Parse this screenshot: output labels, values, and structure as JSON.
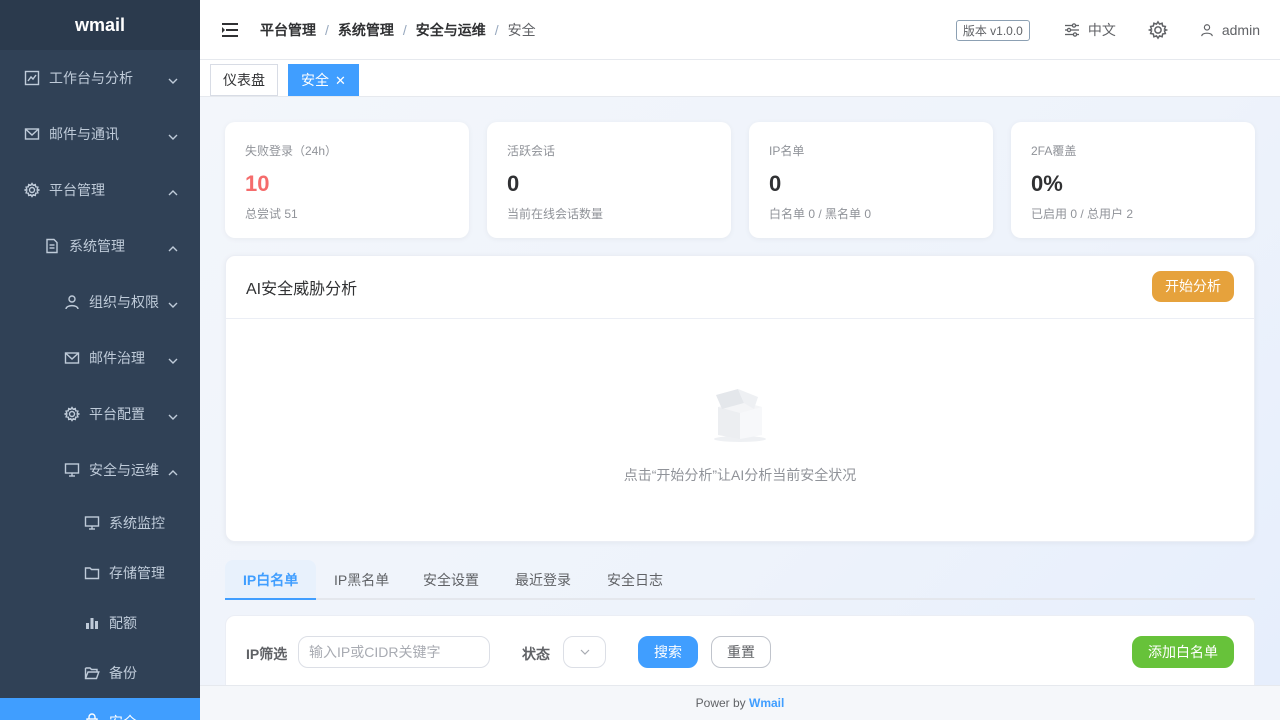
{
  "app": {
    "logo": "wmail"
  },
  "sidebar": {
    "items": [
      {
        "label": "工作台与分析",
        "icon": "chart-icon"
      },
      {
        "label": "邮件与通讯",
        "icon": "mail-icon"
      },
      {
        "label": "平台管理",
        "icon": "gear-icon"
      },
      {
        "label": "系统管理",
        "icon": "document-icon"
      },
      {
        "label": "组织与权限",
        "icon": "user-icon"
      },
      {
        "label": "邮件治理",
        "icon": "mail-icon"
      },
      {
        "label": "平台配置",
        "icon": "gear-icon"
      },
      {
        "label": "安全与运维",
        "icon": "monitor-icon"
      },
      {
        "label": "系统监控",
        "icon": "monitor-icon"
      },
      {
        "label": "存储管理",
        "icon": "folder-icon"
      },
      {
        "label": "配额",
        "icon": "bar-chart-icon"
      },
      {
        "label": "备份",
        "icon": "folder-open-icon"
      },
      {
        "label": "安全",
        "icon": "lock-icon"
      }
    ]
  },
  "header": {
    "breadcrumb": [
      "平台管理",
      "系统管理",
      "安全与运维",
      "安全"
    ],
    "version": "版本 v1.0.0",
    "language": "中文",
    "user": "admin"
  },
  "tags": [
    {
      "label": "仪表盘"
    },
    {
      "label": "安全",
      "close": "✕"
    }
  ],
  "stats": [
    {
      "label": "失败登录（24h）",
      "value": "10",
      "sub": "总尝试 51"
    },
    {
      "label": "活跃会话",
      "value": "0",
      "sub": "当前在线会话数量"
    },
    {
      "label": "IP名单",
      "value": "0",
      "sub": "白名单 0 / 黑名单 0"
    },
    {
      "label": "2FA覆盖",
      "value": "0%",
      "sub": "已启用 0 / 总用户 2"
    }
  ],
  "ai": {
    "title": "AI安全威胁分析",
    "button": "开始分析",
    "empty_text": "点击“开始分析”让AI分析当前安全状况"
  },
  "tabs": [
    "IP白名单",
    "IP黑名单",
    "安全设置",
    "最近登录",
    "安全日志"
  ],
  "filter": {
    "ip_label": "IP筛选",
    "ip_placeholder": "输入IP或CIDR关键字",
    "status_label": "状态",
    "search": "搜索",
    "reset": "重置",
    "add": "添加白名单"
  },
  "footer": {
    "prefix": "Power by",
    "brand": "Wmail"
  },
  "colors": {
    "accent": "#409eff",
    "sidebar": "#304156",
    "danger": "#f56c6c",
    "warning": "#e6a23c",
    "success": "#67c23a"
  }
}
